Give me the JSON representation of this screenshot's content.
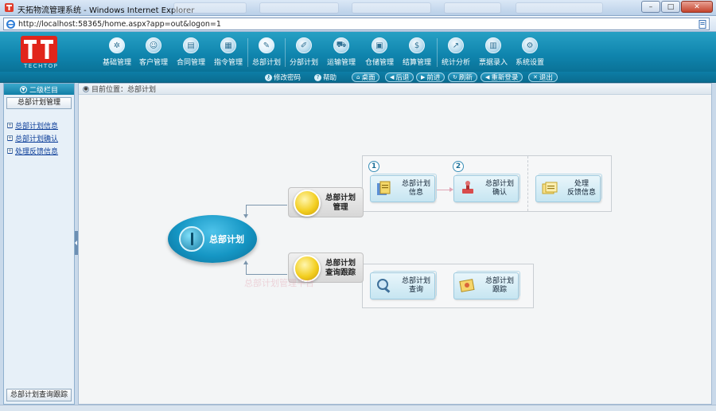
{
  "window": {
    "title": "天拓物流管理系统 - Windows Internet Explorer",
    "min_glyph": "–",
    "max_glyph": "□",
    "close_glyph": "✕"
  },
  "address_bar": {
    "url": "http://localhost:58365/home.aspx?app=out&logon=1"
  },
  "app": {
    "logo_text": "TECHTOP",
    "nav": [
      {
        "label": "基础管理",
        "icon": "gear-icon",
        "glyph": "✲"
      },
      {
        "label": "客户管理",
        "icon": "user-icon",
        "glyph": "☺"
      },
      {
        "label": "合同管理",
        "icon": "contract-icon",
        "glyph": "▤"
      },
      {
        "label": "指令管理",
        "icon": "order-icon",
        "glyph": "▦"
      },
      {
        "label": "总部计划",
        "icon": "hq-plan-icon",
        "glyph": "✎"
      },
      {
        "label": "分部计划",
        "icon": "branch-plan-icon",
        "glyph": "✐"
      },
      {
        "label": "运输管理",
        "icon": "truck-icon",
        "glyph": "⛟"
      },
      {
        "label": "仓储管理",
        "icon": "warehouse-icon",
        "glyph": "▣"
      },
      {
        "label": "结算管理",
        "icon": "dollar-icon",
        "glyph": "$"
      },
      {
        "label": "统计分析",
        "icon": "chart-icon",
        "glyph": "↗"
      },
      {
        "label": "票据录入",
        "icon": "receipt-icon",
        "glyph": "▥"
      },
      {
        "label": "系统设置",
        "icon": "settings-icon",
        "glyph": "⚙"
      }
    ],
    "toolbar": {
      "change_password": "修改密码",
      "help": "帮助",
      "desktop": "桌面",
      "back": "后退",
      "forward": "前进",
      "refresh": "刷新",
      "relogin": "重新登录",
      "logout": "退出"
    }
  },
  "sidebar": {
    "header": "二级栏目",
    "module_button": "总部计划管理",
    "links": [
      "总部计划信息",
      "总部计划确认",
      "处理反馈信息"
    ],
    "bottom_button": "总部计划查询跟踪"
  },
  "main": {
    "breadcrumb": "目前位置：总部计划",
    "watermark": "总部计划管理平台",
    "hub_label": "总部计划",
    "node_manage": {
      "line1": "总部计划",
      "line2": "管理"
    },
    "node_query": {
      "line1": "总部计划",
      "line2": "查询跟踪"
    },
    "sub_info": {
      "line1": "总部计划",
      "line2": "信息",
      "step": "1"
    },
    "sub_confirm": {
      "line1": "总部计划",
      "line2": "确认",
      "step": "2"
    },
    "sub_feedback": {
      "line1": "处理",
      "line2": "反馈信息"
    },
    "sub_query": {
      "line1": "总部计划",
      "line2": "查询"
    },
    "sub_track": {
      "line1": "总部计划",
      "line2": "跟踪"
    }
  },
  "colors": {
    "header_blue": "#1596c4",
    "node_yellow": "#f3cf21",
    "link_blue": "#0b3d99"
  }
}
